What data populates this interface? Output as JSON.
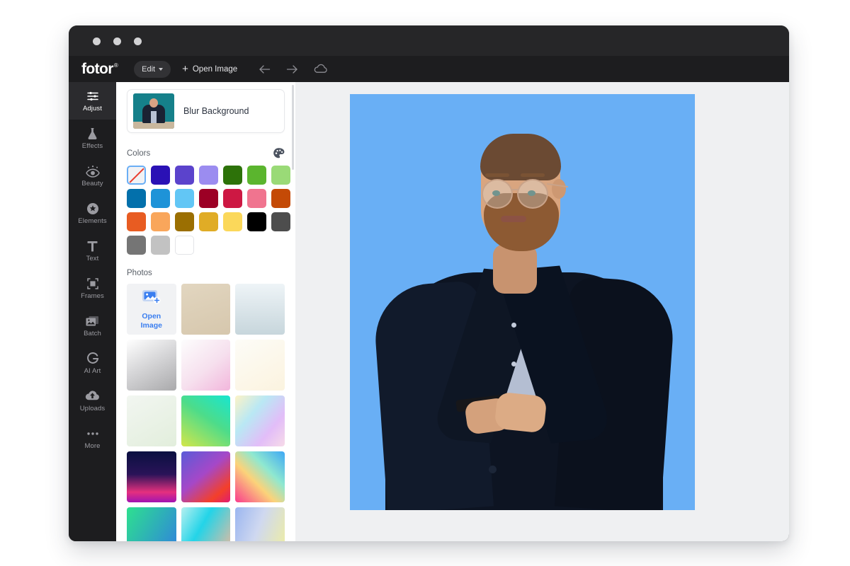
{
  "app": {
    "brand": "fotor",
    "brand_mark": "®",
    "window_dots": [
      "close-dot",
      "minimize-dot",
      "maximize-dot"
    ]
  },
  "toolbar": {
    "edit_label": "Edit",
    "open_image_label": "Open Image",
    "plus": "+",
    "undo_icon": "arrow-left-icon",
    "redo_icon": "arrow-right-icon",
    "cloud_icon": "cloud-icon",
    "undo_glyph": "←",
    "redo_glyph": "→"
  },
  "sidebar": {
    "items": [
      {
        "label": "Adjust",
        "icon": "sliders-icon",
        "active": true
      },
      {
        "label": "Effects",
        "icon": "flask-icon",
        "active": false
      },
      {
        "label": "Beauty",
        "icon": "eye-icon",
        "active": false
      },
      {
        "label": "Elements",
        "icon": "star-badge-icon",
        "active": false
      },
      {
        "label": "Text",
        "icon": "text-t-icon",
        "active": false
      },
      {
        "label": "Frames",
        "icon": "frame-icon",
        "active": false
      },
      {
        "label": "Batch",
        "icon": "batch-images-icon",
        "active": false
      },
      {
        "label": "AI Art",
        "icon": "ai-art-icon",
        "active": false
      },
      {
        "label": "Uploads",
        "icon": "upload-cloud-icon",
        "active": false
      },
      {
        "label": "More",
        "icon": "ellipsis-icon",
        "active": false
      }
    ]
  },
  "panel": {
    "blur_background_label": "Blur Background",
    "colors_title": "Colors",
    "palette_icon": "palette-icon",
    "photos_title": "Photos",
    "open_image_tile_label": "Open\nImage",
    "open_image_tile_line1": "Open",
    "open_image_tile_line2": "Image",
    "open_image_tile_icon": "add-photo-icon",
    "selected_color": "transparent",
    "colors": [
      {
        "name": "transparent",
        "hex": "transparent",
        "selected": true
      },
      {
        "name": "dark-blue-violet",
        "hex": "#2a11b5",
        "selected": false
      },
      {
        "name": "medium-purple",
        "hex": "#5b43cc",
        "selected": false
      },
      {
        "name": "light-purple",
        "hex": "#9b8cf0",
        "selected": false
      },
      {
        "name": "dark-green",
        "hex": "#2d7209",
        "selected": false
      },
      {
        "name": "medium-green",
        "hex": "#5bb52e",
        "selected": false
      },
      {
        "name": "light-green",
        "hex": "#9ada77",
        "selected": false
      },
      {
        "name": "dark-cyan-blue",
        "hex": "#0370ab",
        "selected": false
      },
      {
        "name": "medium-blue",
        "hex": "#1e93d8",
        "selected": false
      },
      {
        "name": "light-sky-blue",
        "hex": "#62c6f5",
        "selected": false
      },
      {
        "name": "dark-crimson",
        "hex": "#9c0025",
        "selected": false
      },
      {
        "name": "crimson-red",
        "hex": "#cd1843",
        "selected": false
      },
      {
        "name": "pink",
        "hex": "#f0748f",
        "selected": false
      },
      {
        "name": "burnt-orange",
        "hex": "#c44a06",
        "selected": false
      },
      {
        "name": "orange",
        "hex": "#e85c22",
        "selected": false
      },
      {
        "name": "light-orange",
        "hex": "#f9a65b",
        "selected": false
      },
      {
        "name": "dark-gold",
        "hex": "#9b6f02",
        "selected": false
      },
      {
        "name": "gold",
        "hex": "#e0ac26",
        "selected": false
      },
      {
        "name": "light-yellow",
        "hex": "#fbd85a",
        "selected": false
      },
      {
        "name": "black",
        "hex": "#000000",
        "selected": false
      },
      {
        "name": "dark-gray",
        "hex": "#4d4d4d",
        "selected": false
      },
      {
        "name": "gray",
        "hex": "#757575",
        "selected": false
      },
      {
        "name": "light-gray",
        "hex": "#c2c2c2",
        "selected": false
      },
      {
        "name": "white",
        "hex": "#ffffff",
        "selected": false
      }
    ],
    "photos": [
      {
        "name": "open-image-tile",
        "kind": "action"
      },
      {
        "name": "beige-solid",
        "kind": "gradient",
        "css": "linear-gradient(160deg,#e2d6c0 0%,#d6c7ad 100%)"
      },
      {
        "name": "pale-blue-gradient",
        "kind": "gradient",
        "css": "linear-gradient(180deg,#eef4f7 0%,#c7d6dc 100%)"
      },
      {
        "name": "silver-gradient",
        "kind": "gradient",
        "css": "linear-gradient(150deg,#ffffff 0%,#d7d7d9 45%,#a9a9ab 100%)"
      },
      {
        "name": "pink-white-gradient",
        "kind": "gradient",
        "css": "linear-gradient(140deg,#fdfdfd 0%,#f6e0ee 55%,#f2b6dc 100%)"
      },
      {
        "name": "cream-gradient",
        "kind": "gradient",
        "css": "linear-gradient(150deg,#fdfcf7 0%,#fbf3df 100%)"
      },
      {
        "name": "pale-green-gradient",
        "kind": "gradient",
        "css": "linear-gradient(150deg,#f2f6f1 0%,#e2eedc 100%)"
      },
      {
        "name": "green-cyan-gradient",
        "kind": "gradient",
        "css": "linear-gradient(215deg,#18e6d0 0%,#4ddc8a 45%,#d3e64a 100%)"
      },
      {
        "name": "pastel-rainbow-gradient",
        "kind": "gradient",
        "css": "linear-gradient(130deg,#fdf3c6 0%,#b9e8f4 35%,#e2bdf8 70%,#f7dbe8 100%)"
      },
      {
        "name": "navy-magenta-gradient",
        "kind": "gradient",
        "css": "linear-gradient(180deg,#0a1040 0%,#2a1358 45%,#e5307e 80%,#a114b2 100%)"
      },
      {
        "name": "purple-red-gradient",
        "kind": "gradient",
        "css": "linear-gradient(140deg,#5a5bd8 0%,#a548c8 45%,#f3402a 80%,#e01b72 100%)"
      },
      {
        "name": "sunset-cyan-gradient",
        "kind": "gradient",
        "css": "linear-gradient(225deg,#3ea8f5 0%,#8fe8d0 35%,#fbd37a 60%,#fa3b8d 100%)"
      },
      {
        "name": "green-blue-gradient",
        "kind": "gradient",
        "css": "linear-gradient(120deg,#2ee08f 0%,#2f7fe0 100%)"
      },
      {
        "name": "cyan-peach-gradient",
        "kind": "gradient",
        "css": "linear-gradient(120deg,#b6f0f0 0%,#23d4e8 40%,#f6b89a 100%)"
      },
      {
        "name": "blue-yellow-gradient",
        "kind": "gradient",
        "css": "linear-gradient(110deg,#9bb6f0 0%,#cfd8f0 45%,#f0ef9e 100%)"
      }
    ]
  },
  "canvas": {
    "background_color": "#eff0f2",
    "artboard_color": "#69aff5",
    "subject_alt": "man-in-dark-suit-holding-phone"
  }
}
